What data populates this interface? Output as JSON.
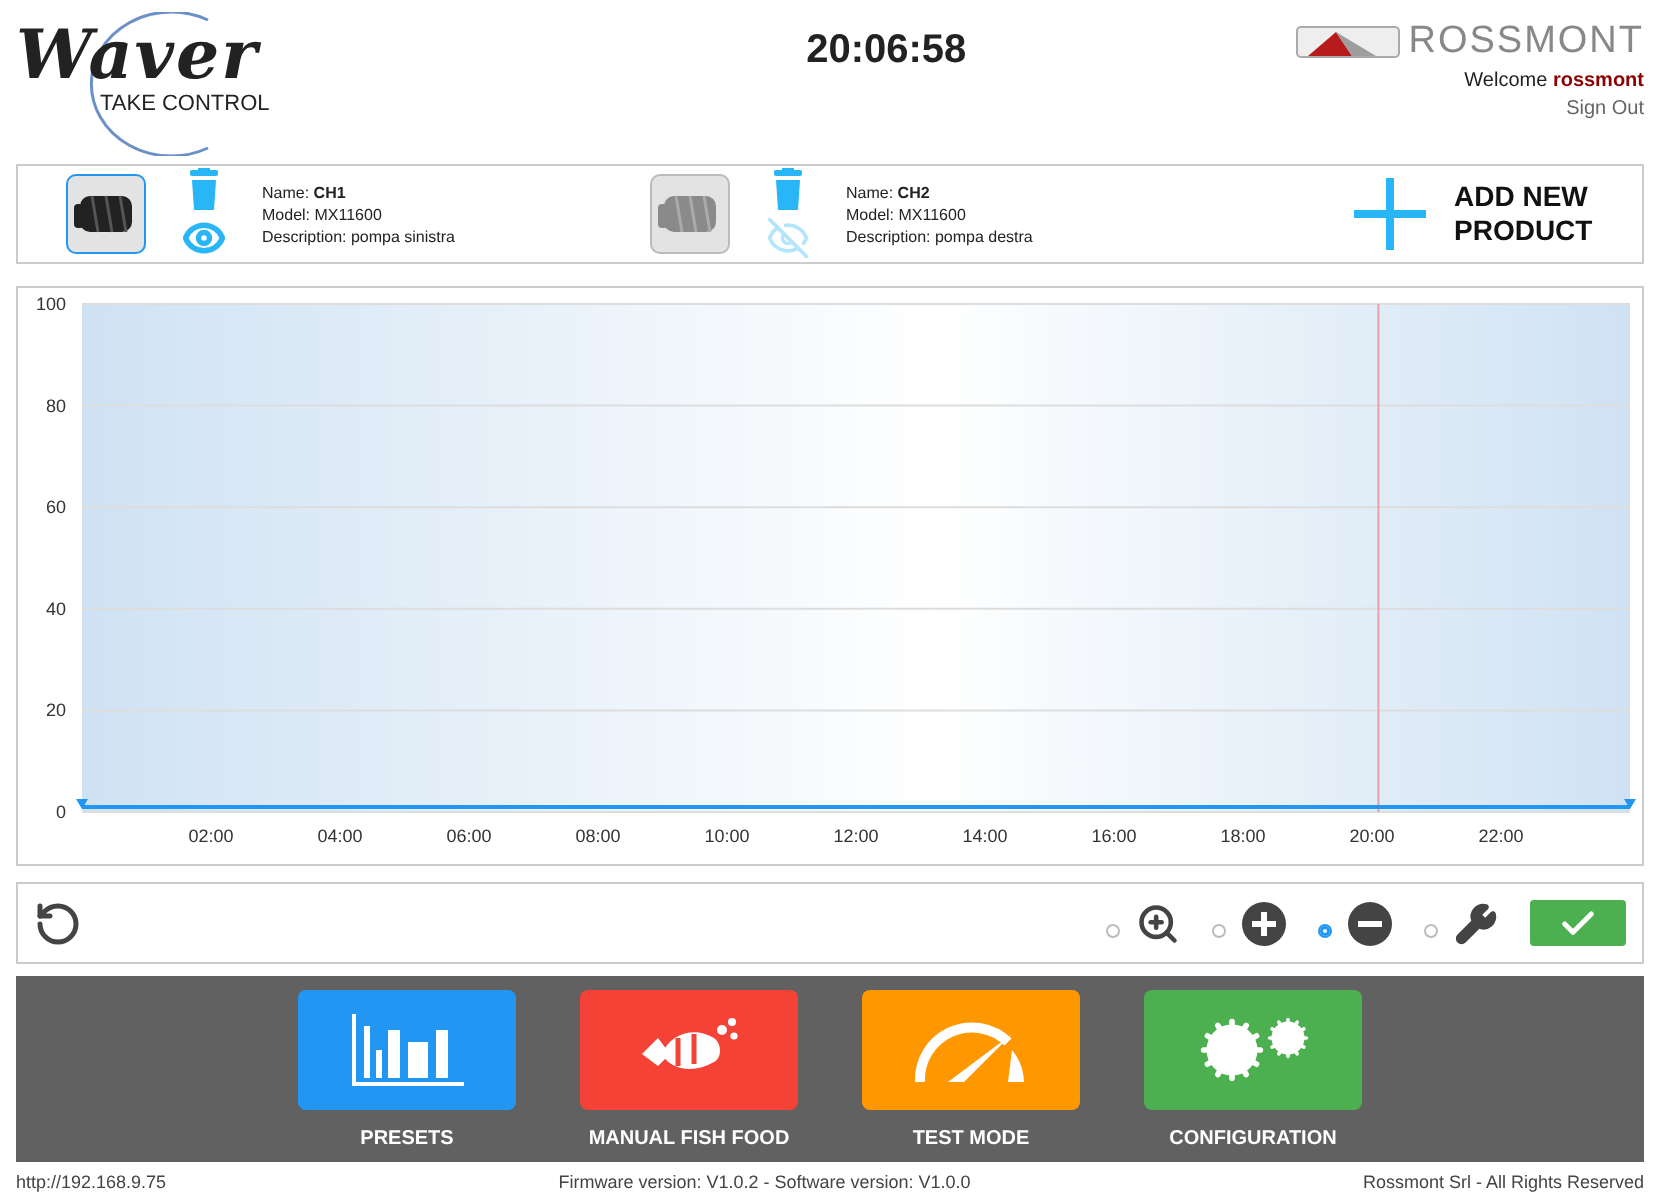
{
  "header": {
    "logo": {
      "title": "Waver",
      "tagline": "TAKE CONTROL"
    },
    "clock": "20:06:58",
    "brand": "ROSSMONT",
    "welcome": "Welcome",
    "user": "rossmont",
    "sign_out": "Sign Out"
  },
  "products": [
    {
      "name": "Name: **CH1**",
      "model": "Model: MX11600",
      "description": "Description: pompa sinistra",
      "selected": true,
      "visible": true
    },
    {
      "name": "Name: **CH2**",
      "model": "Model: MX11600",
      "description": "Description: pompa destra",
      "selected": false,
      "visible": false
    }
  ],
  "add_product": "ADD NEW PRODUCT",
  "chart_data": {
    "type": "line",
    "x": [
      0,
      24
    ],
    "series": [
      {
        "color": "#2196f3",
        "marker": "triangle",
        "values": [
          1,
          1
        ]
      }
    ],
    "grid": true,
    "xlim": [
      0,
      24
    ],
    "ylim": [
      0,
      100
    ],
    "xticks": [
      {
        "value": 2,
        "label": "02:00"
      },
      {
        "value": 4,
        "label": "04:00"
      },
      {
        "value": 6,
        "label": "06:00"
      },
      {
        "value": 8,
        "label": "08:00"
      },
      {
        "value": 10,
        "label": "10:00"
      },
      {
        "value": 12,
        "label": "12:00"
      },
      {
        "value": 14,
        "label": "14:00"
      },
      {
        "value": 16,
        "label": "16:00"
      },
      {
        "value": 18,
        "label": "18:00"
      },
      {
        "value": 20,
        "label": "20:00"
      },
      {
        "value": 22,
        "label": "22:00"
      }
    ],
    "yticks": [
      0,
      20,
      40,
      60,
      80,
      100
    ],
    "ref_lines": [
      {
        "axis": "x",
        "value": 20.1,
        "color": "#e8a0a8"
      }
    ]
  },
  "tools": [
    {
      "kind": "zoom",
      "selected": false
    },
    {
      "kind": "plus",
      "selected": false
    },
    {
      "kind": "minus",
      "selected": true
    },
    {
      "kind": "wrench",
      "selected": false
    }
  ],
  "nav": [
    {
      "kind": "presets",
      "label": "PRESETS",
      "color": "#2196f3"
    },
    {
      "kind": "food",
      "label": "MANUAL FISH FOOD",
      "color": "#f44336"
    },
    {
      "kind": "test",
      "label": "TEST MODE",
      "color": "#ff9800"
    },
    {
      "kind": "config",
      "label": "CONFIGURATION",
      "color": "#4caf50"
    }
  ],
  "status_bar": {
    "address": "http://192.168.9.75",
    "versions": "Firmware version: V1.0.2 - Software version: V1.0.0",
    "copyright": "Rossmont Srl - All Rights Reserved"
  }
}
